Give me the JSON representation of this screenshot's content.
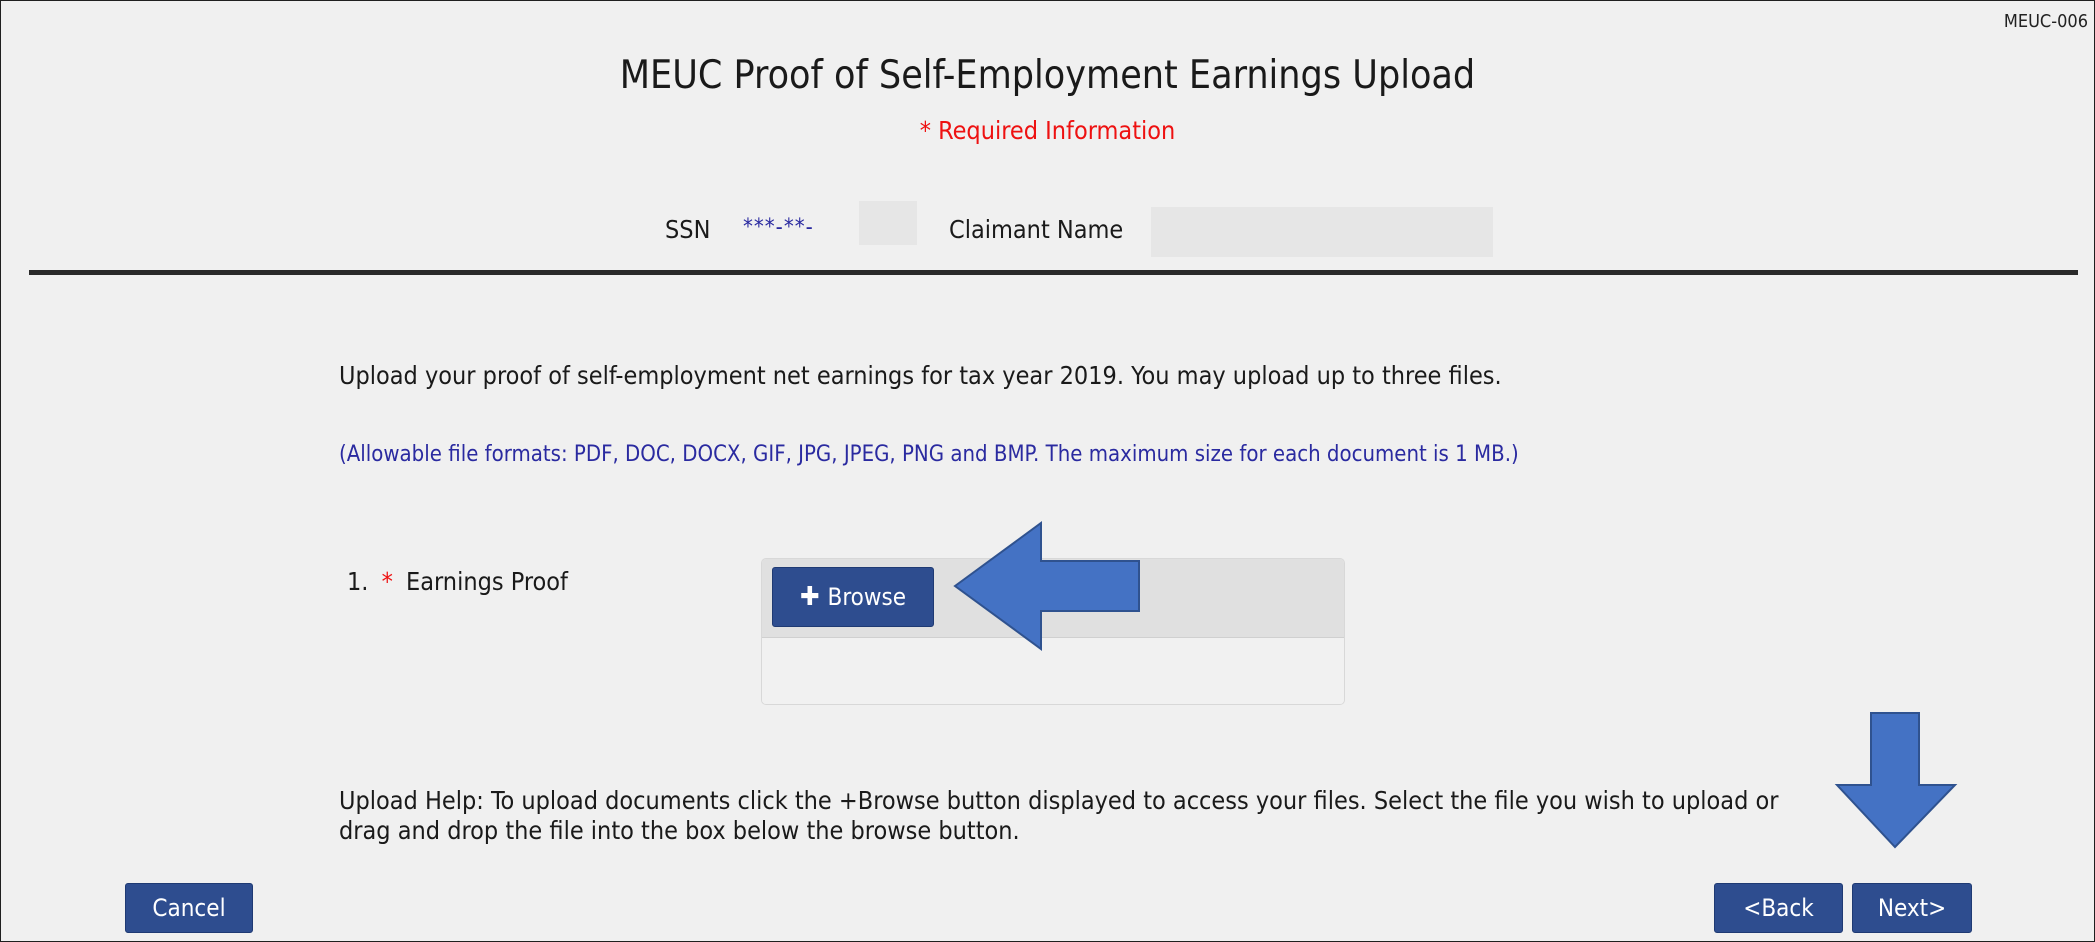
{
  "page": {
    "code": "MEUC-006",
    "title": "MEUC Proof of Self-Employment Earnings Upload",
    "required_note": "* Required Information"
  },
  "identity": {
    "ssn_label": "SSN",
    "ssn_value": "***-**-",
    "claimant_label": "Claimant Name",
    "claimant_value": ""
  },
  "content": {
    "intro": "Upload your proof of self-employment net earnings for tax year 2019. You may upload up to three files.",
    "formats_note": "(Allowable file formats: PDF, DOC, DOCX, GIF, JPG, JPEG, PNG and BMP. The maximum size for each document is 1 MB.)",
    "help": "Upload Help: To upload documents click the +Browse button displayed to access your files. Select the file you wish to upload or drag and drop the file into the box below the browse button."
  },
  "upload_fields": [
    {
      "number": "1.",
      "required_mark": "*",
      "label": "Earnings Proof",
      "browse_label": "Browse",
      "browse_icon": "plus-icon"
    }
  ],
  "buttons": {
    "cancel": "Cancel",
    "back": "<Back",
    "next": "Next>"
  },
  "annotations": {
    "arrow_color": "#4472c4",
    "arrow_border_color": "#2f528f",
    "arrows": [
      "left-arrow-pointing-at-browse",
      "down-arrow-pointing-at-next"
    ]
  },
  "colors": {
    "button": "#2e4d8f",
    "required_red": "#ee1111",
    "info_blue": "#2a2aa0",
    "background": "#f0f0f0"
  }
}
